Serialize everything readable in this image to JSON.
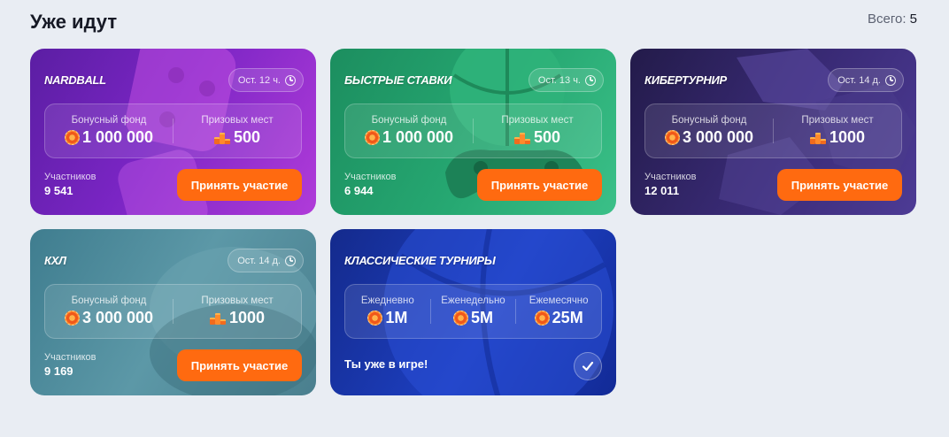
{
  "header": {
    "title": "Уже идут",
    "total_label": "Всего:",
    "total_count": "5"
  },
  "cards": [
    {
      "title": "NARDBALL",
      "timer": "Ост. 12 ч.",
      "fund_label": "Бонусный фонд",
      "fund_value": "1 000 000",
      "places_label": "Призовых мест",
      "places_value": "500",
      "participants_label": "Участников",
      "participants_value": "9 541",
      "button_label": "Принять участие",
      "bg_color": "#7a25c4"
    },
    {
      "title": "БЫСТРЫЕ СТАВКИ",
      "timer": "Ост. 13 ч.",
      "fund_label": "Бонусный фонд",
      "fund_value": "1 000 000",
      "places_label": "Призовых мест",
      "places_value": "500",
      "participants_label": "Участников",
      "participants_value": "6 944",
      "button_label": "Принять участие",
      "bg_color": "#26a872"
    },
    {
      "title": "КИБЕРТУРНИР",
      "timer": "Ост. 14 д.",
      "fund_label": "Бонусный фонд",
      "fund_value": "3 000 000",
      "places_label": "Призовых мест",
      "places_value": "1000",
      "participants_label": "Участников",
      "participants_value": "12 011",
      "button_label": "Принять участие",
      "bg_color": "#3a2b77"
    },
    {
      "title": "КХЛ",
      "timer": "Ост. 14 д.",
      "fund_label": "Бонусный фонд",
      "fund_value": "3 000 000",
      "places_label": "Призовых мест",
      "places_value": "1000",
      "participants_label": "Участников",
      "participants_value": "9 169",
      "button_label": "Принять участие",
      "bg_color": "#5c98a7"
    }
  ],
  "classic": {
    "title": "КЛАССИЧЕСКИЕ ТУРНИРЫ",
    "daily_label": "Ежедневно",
    "daily_value": "1M",
    "weekly_label": "Еженедельно",
    "weekly_value": "5M",
    "monthly_label": "Ежемесячно",
    "monthly_value": "25M",
    "status": "Ты уже в игре!",
    "bg_color": "#1d3fc0"
  },
  "accent_color": "#ff6a10"
}
